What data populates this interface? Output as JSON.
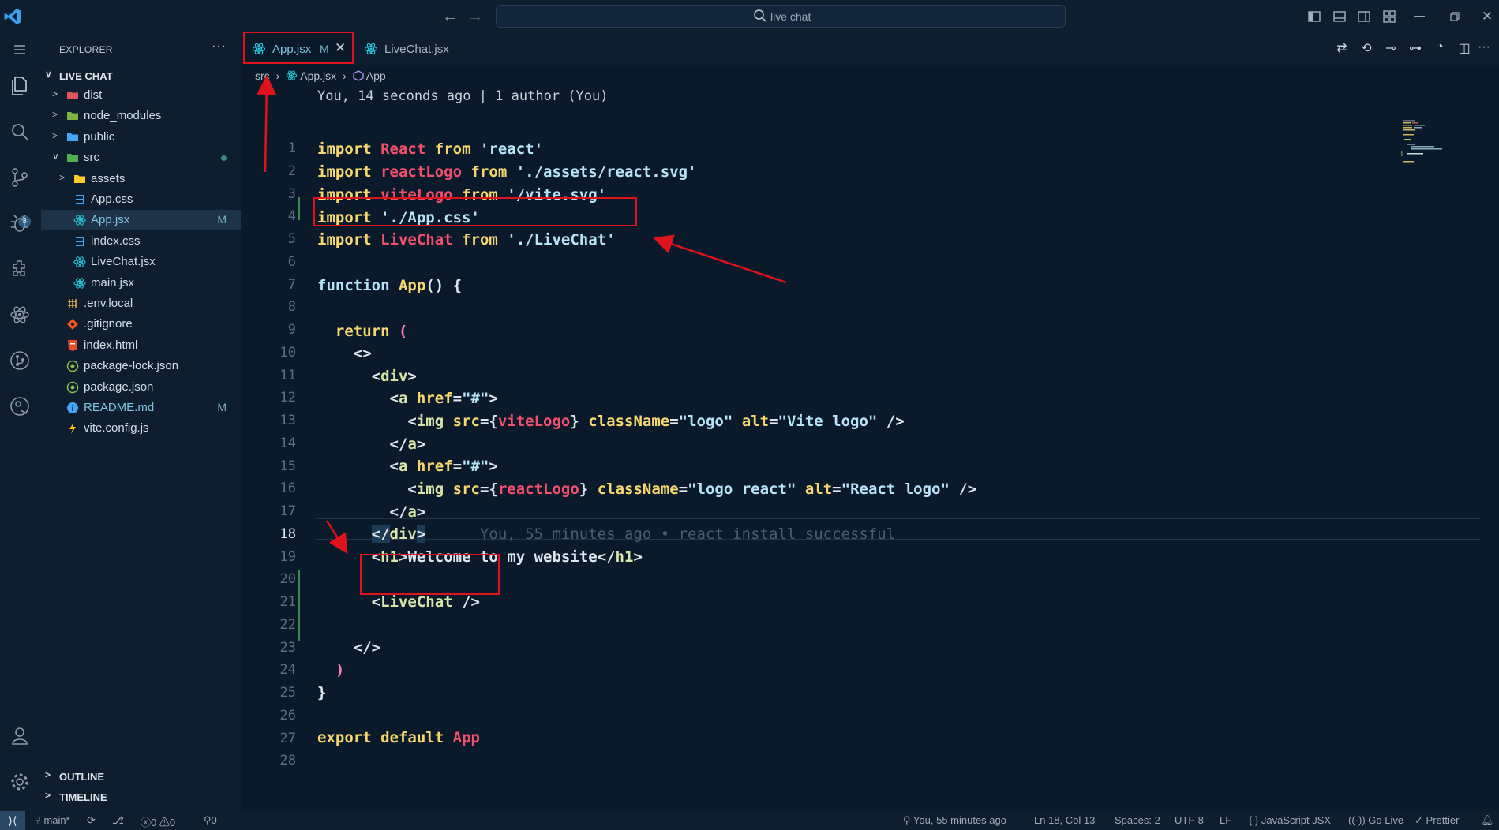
{
  "titlebar": {
    "search_text": "live chat"
  },
  "explorer": {
    "header": "EXPLORER",
    "more": "···",
    "root_folder": "LIVE CHAT",
    "items": [
      {
        "name": "dist",
        "kind": "folder",
        "icon": "folder-dist-icon",
        "color": "#e0545c"
      },
      {
        "name": "node_modules",
        "kind": "folder",
        "icon": "folder-node-icon",
        "color": "#7cb342"
      },
      {
        "name": "public",
        "kind": "folder",
        "icon": "folder-public-icon",
        "color": "#42a5f5"
      },
      {
        "name": "src",
        "kind": "folder-open",
        "icon": "folder-src-icon",
        "color": "#4caf50"
      },
      {
        "name": "assets",
        "kind": "folder",
        "icon": "folder-assets-icon",
        "color": "#ffca28"
      },
      {
        "name": "App.css",
        "kind": "file",
        "icon": "css-file-icon",
        "color": "#42a5f5"
      },
      {
        "name": "App.jsx",
        "kind": "file",
        "icon": "react-file-icon",
        "color": "#26c6da",
        "decoration": "M"
      },
      {
        "name": "index.css",
        "kind": "file",
        "icon": "css-file-icon",
        "color": "#42a5f5"
      },
      {
        "name": "LiveChat.jsx",
        "kind": "file",
        "icon": "react-file-icon",
        "color": "#26c6da"
      },
      {
        "name": "main.jsx",
        "kind": "file",
        "icon": "react-file-icon",
        "color": "#26c6da"
      },
      {
        "name": ".env.local",
        "kind": "file",
        "icon": "env-file-icon",
        "color": "#e9b44c"
      },
      {
        "name": ".gitignore",
        "kind": "file",
        "icon": "git-file-icon",
        "color": "#f4511e"
      },
      {
        "name": "index.html",
        "kind": "file",
        "icon": "html-file-icon",
        "color": "#e44d26"
      },
      {
        "name": "package-lock.json",
        "kind": "file",
        "icon": "npm-file-icon",
        "color": "#8bc34a"
      },
      {
        "name": "package.json",
        "kind": "file",
        "icon": "npm-file-icon",
        "color": "#8bc34a"
      },
      {
        "name": "README.md",
        "kind": "file",
        "icon": "info-file-icon",
        "color": "#42a5f5",
        "decoration": "M"
      },
      {
        "name": "vite.config.js",
        "kind": "file",
        "icon": "vite-file-icon",
        "color": "#ffc107"
      }
    ],
    "outline": "OUTLINE",
    "timeline": "TIMELINE"
  },
  "tabs": [
    {
      "label": "App.jsx",
      "modified": "M",
      "active": true
    },
    {
      "label": "LiveChat.jsx",
      "active": false
    }
  ],
  "breadcrumb": [
    "src",
    "App.jsx",
    "App"
  ],
  "codelens": "You, 14 seconds ago | 1 author (You)",
  "code": {
    "active_line": 18,
    "line_numbers": [
      "1",
      "2",
      "3",
      "4",
      "5",
      "6",
      "7",
      "8",
      "9",
      "10",
      "11",
      "12",
      "13",
      "14",
      "15",
      "16",
      "17",
      "18",
      "19",
      "20",
      "21",
      "22",
      "23",
      "24",
      "25",
      "26",
      "27",
      "28"
    ],
    "blame": "You, 55 minutes ago • react install successful"
  },
  "status": {
    "branch": "main*",
    "errors": "0",
    "warnings": "0",
    "ports": "0",
    "blame": "You, 55 minutes ago",
    "position": "Ln 18, Col 13",
    "spaces": "Spaces: 2",
    "encoding": "UTF-8",
    "eol": "LF",
    "language": "JavaScript JSX",
    "golive": "Go Live",
    "prettier": "Prettier"
  },
  "colors": {
    "annotation": "#e0121c",
    "keyword": "#f6d66f",
    "identifier": "#f0506e",
    "string": "#b6e3f5"
  }
}
